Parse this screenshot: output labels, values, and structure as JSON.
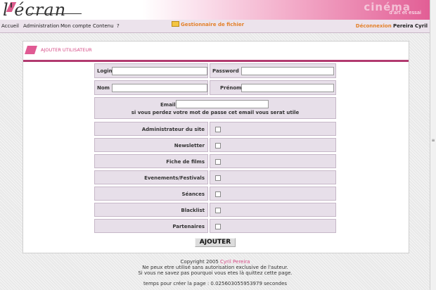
{
  "header": {
    "logo_text": "l'écran",
    "brand_title": "cinéma",
    "brand_subtitle": "d'art et essai"
  },
  "nav": {
    "items": [
      "Accueil",
      "Administration",
      "Mon compte",
      "Contenu",
      "?"
    ],
    "file_manager": "Gestionnaire de fichier",
    "logout": "Déconnexion",
    "username": "Pereira Cyril"
  },
  "panel": {
    "title": "AJOUTER UTILISATEUR"
  },
  "form": {
    "login_label": "Login",
    "login_value": "",
    "password_label": "Password",
    "password_value": "",
    "nom_label": "Nom",
    "nom_value": "",
    "prenom_label": "Prénom",
    "prenom_value": "",
    "email_label": "Email",
    "email_value": "",
    "email_hint": "si vous perdez votre mot de passe cet email vous serat utile",
    "permissions": [
      {
        "label": "Administrateur du site",
        "checked": false
      },
      {
        "label": "Newsletter",
        "checked": false
      },
      {
        "label": "Fiche de films",
        "checked": false
      },
      {
        "label": "Evenements/Festivals",
        "checked": false
      },
      {
        "label": "Séances",
        "checked": false
      },
      {
        "label": "Blacklist",
        "checked": false
      },
      {
        "label": "Partenaires",
        "checked": false
      }
    ],
    "submit_label": "AJOUTER"
  },
  "footer": {
    "copyright_prefix": "Copyright 2005",
    "author": "Cyril Pereira",
    "line2": "Ne peux etre utilisé sans autorisation exclusive de l'auteur.",
    "line3": "Si vous ne savez pas pourquoi vous etes là quittez cette page.",
    "line4": "temps pour créer la page : 0.025603055953979 secondes"
  }
}
